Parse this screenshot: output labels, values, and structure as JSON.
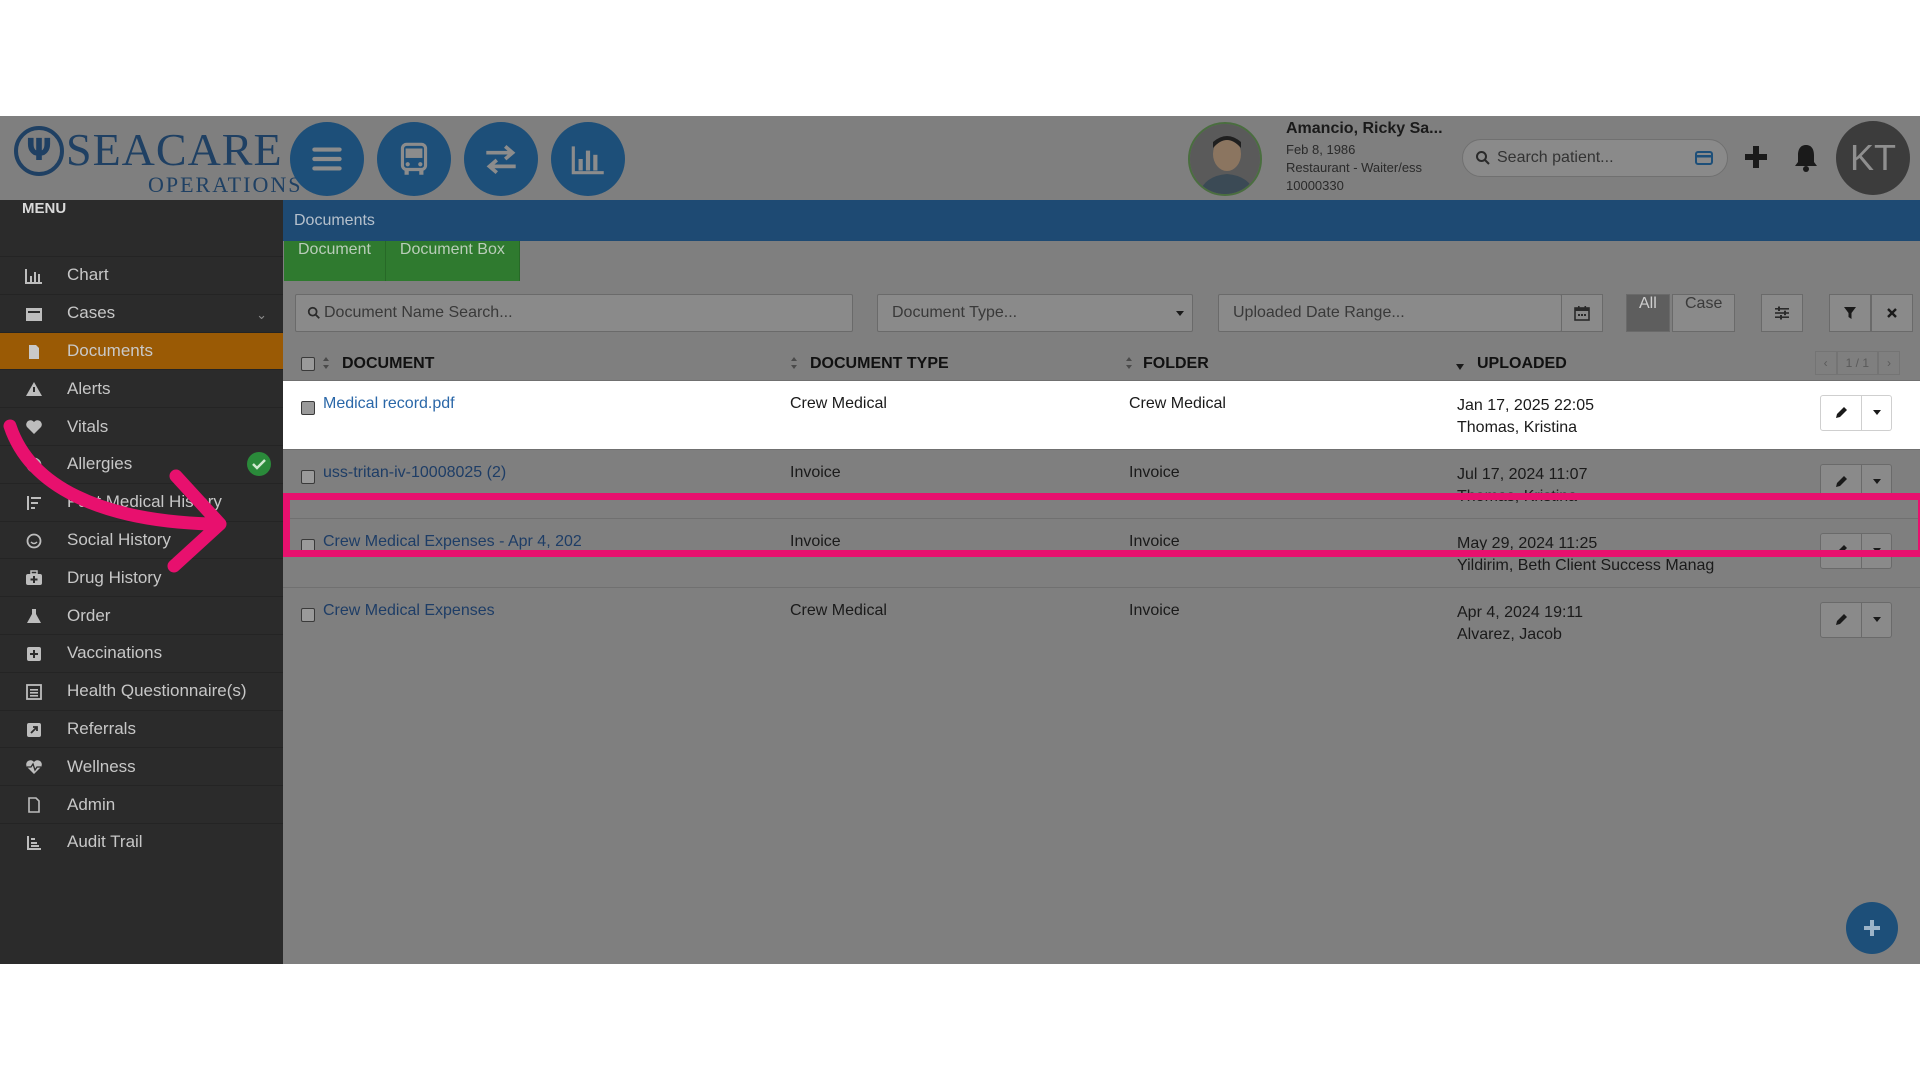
{
  "brand": {
    "name": "SEACARE",
    "sub": "OPERATIONS"
  },
  "header_buttons": [
    {
      "icon": "hamburger-menu-icon"
    },
    {
      "icon": "bus-icon"
    },
    {
      "icon": "transfer-arrows-icon"
    },
    {
      "icon": "bar-chart-icon"
    }
  ],
  "patient": {
    "name": "Amancio, Ricky Sa...",
    "dob": "Feb 8, 1986",
    "role": "Restaurant - Waiter/ess",
    "id": "10000330"
  },
  "search": {
    "placeholder": "Search patient..."
  },
  "user": {
    "initials": "KT"
  },
  "sidebar": {
    "title": "MENU",
    "items": [
      {
        "label": "Chart",
        "icon": "bar-chart-icon"
      },
      {
        "label": "Cases",
        "icon": "case-icon"
      },
      {
        "label": "Documents",
        "icon": "document-icon"
      },
      {
        "label": "Alerts",
        "icon": "warning-icon"
      },
      {
        "label": "Vitals",
        "icon": "heart-icon"
      },
      {
        "label": "Allergies",
        "icon": "allergy-icon"
      },
      {
        "label": "Past Medical History",
        "icon": "history-sort-icon"
      },
      {
        "label": "Social History",
        "icon": "smile-icon"
      },
      {
        "label": "Drug History",
        "icon": "medkit-icon"
      },
      {
        "label": "Order",
        "icon": "flask-icon"
      },
      {
        "label": "Vaccinations",
        "icon": "plus-square-icon"
      },
      {
        "label": "Health Questionnaire(s)",
        "icon": "list-icon"
      },
      {
        "label": "Referrals",
        "icon": "referral-icon"
      },
      {
        "label": "Wellness",
        "icon": "heartbeat-icon"
      },
      {
        "label": "Admin",
        "icon": "file-icon"
      },
      {
        "label": "Audit Trail",
        "icon": "audit-icon"
      }
    ]
  },
  "page": {
    "breadcrumb": "Documents",
    "tabs": [
      "Document",
      "Document Box"
    ],
    "filters": {
      "name_placeholder": "Document Name Search...",
      "type_placeholder": "Document Type...",
      "date_placeholder": "Uploaded Date Range...",
      "scope_all": "All",
      "scope_case": "Case"
    },
    "columns": {
      "document": "DOCUMENT",
      "type": "DOCUMENT TYPE",
      "folder": "FOLDER",
      "uploaded": "UPLOADED"
    },
    "pager": {
      "prev": "‹",
      "page": "1 / 1",
      "next": "›"
    },
    "rows": [
      {
        "document": "Medical record.pdf",
        "type": "Crew Medical",
        "folder": "Crew Medical",
        "date": "Jan 17, 2025 22:05",
        "by": "Thomas, Kristina"
      },
      {
        "document": "uss-tritan-iv-10008025 (2)",
        "type": "Invoice",
        "folder": "Invoice",
        "date": "Jul 17, 2024 11:07",
        "by": "Thomas, Kristina"
      },
      {
        "document": "Crew Medical Expenses - Apr 4, 202",
        "type": "Invoice",
        "folder": "Invoice",
        "date": "May 29, 2024 11:25",
        "by": "Yildirim, Beth Client Success Manag"
      },
      {
        "document": "Crew Medical Expenses",
        "type": "Crew Medical",
        "folder": "Invoice",
        "date": "Apr 4, 2024 19:11",
        "by": "Alvarez, Jacob"
      }
    ]
  },
  "colors": {
    "header_blue": "#1d4f79",
    "active_orange": "#9a5a05",
    "tab_green": "#2f7a2f",
    "highlight_pink": "#e8106e"
  }
}
